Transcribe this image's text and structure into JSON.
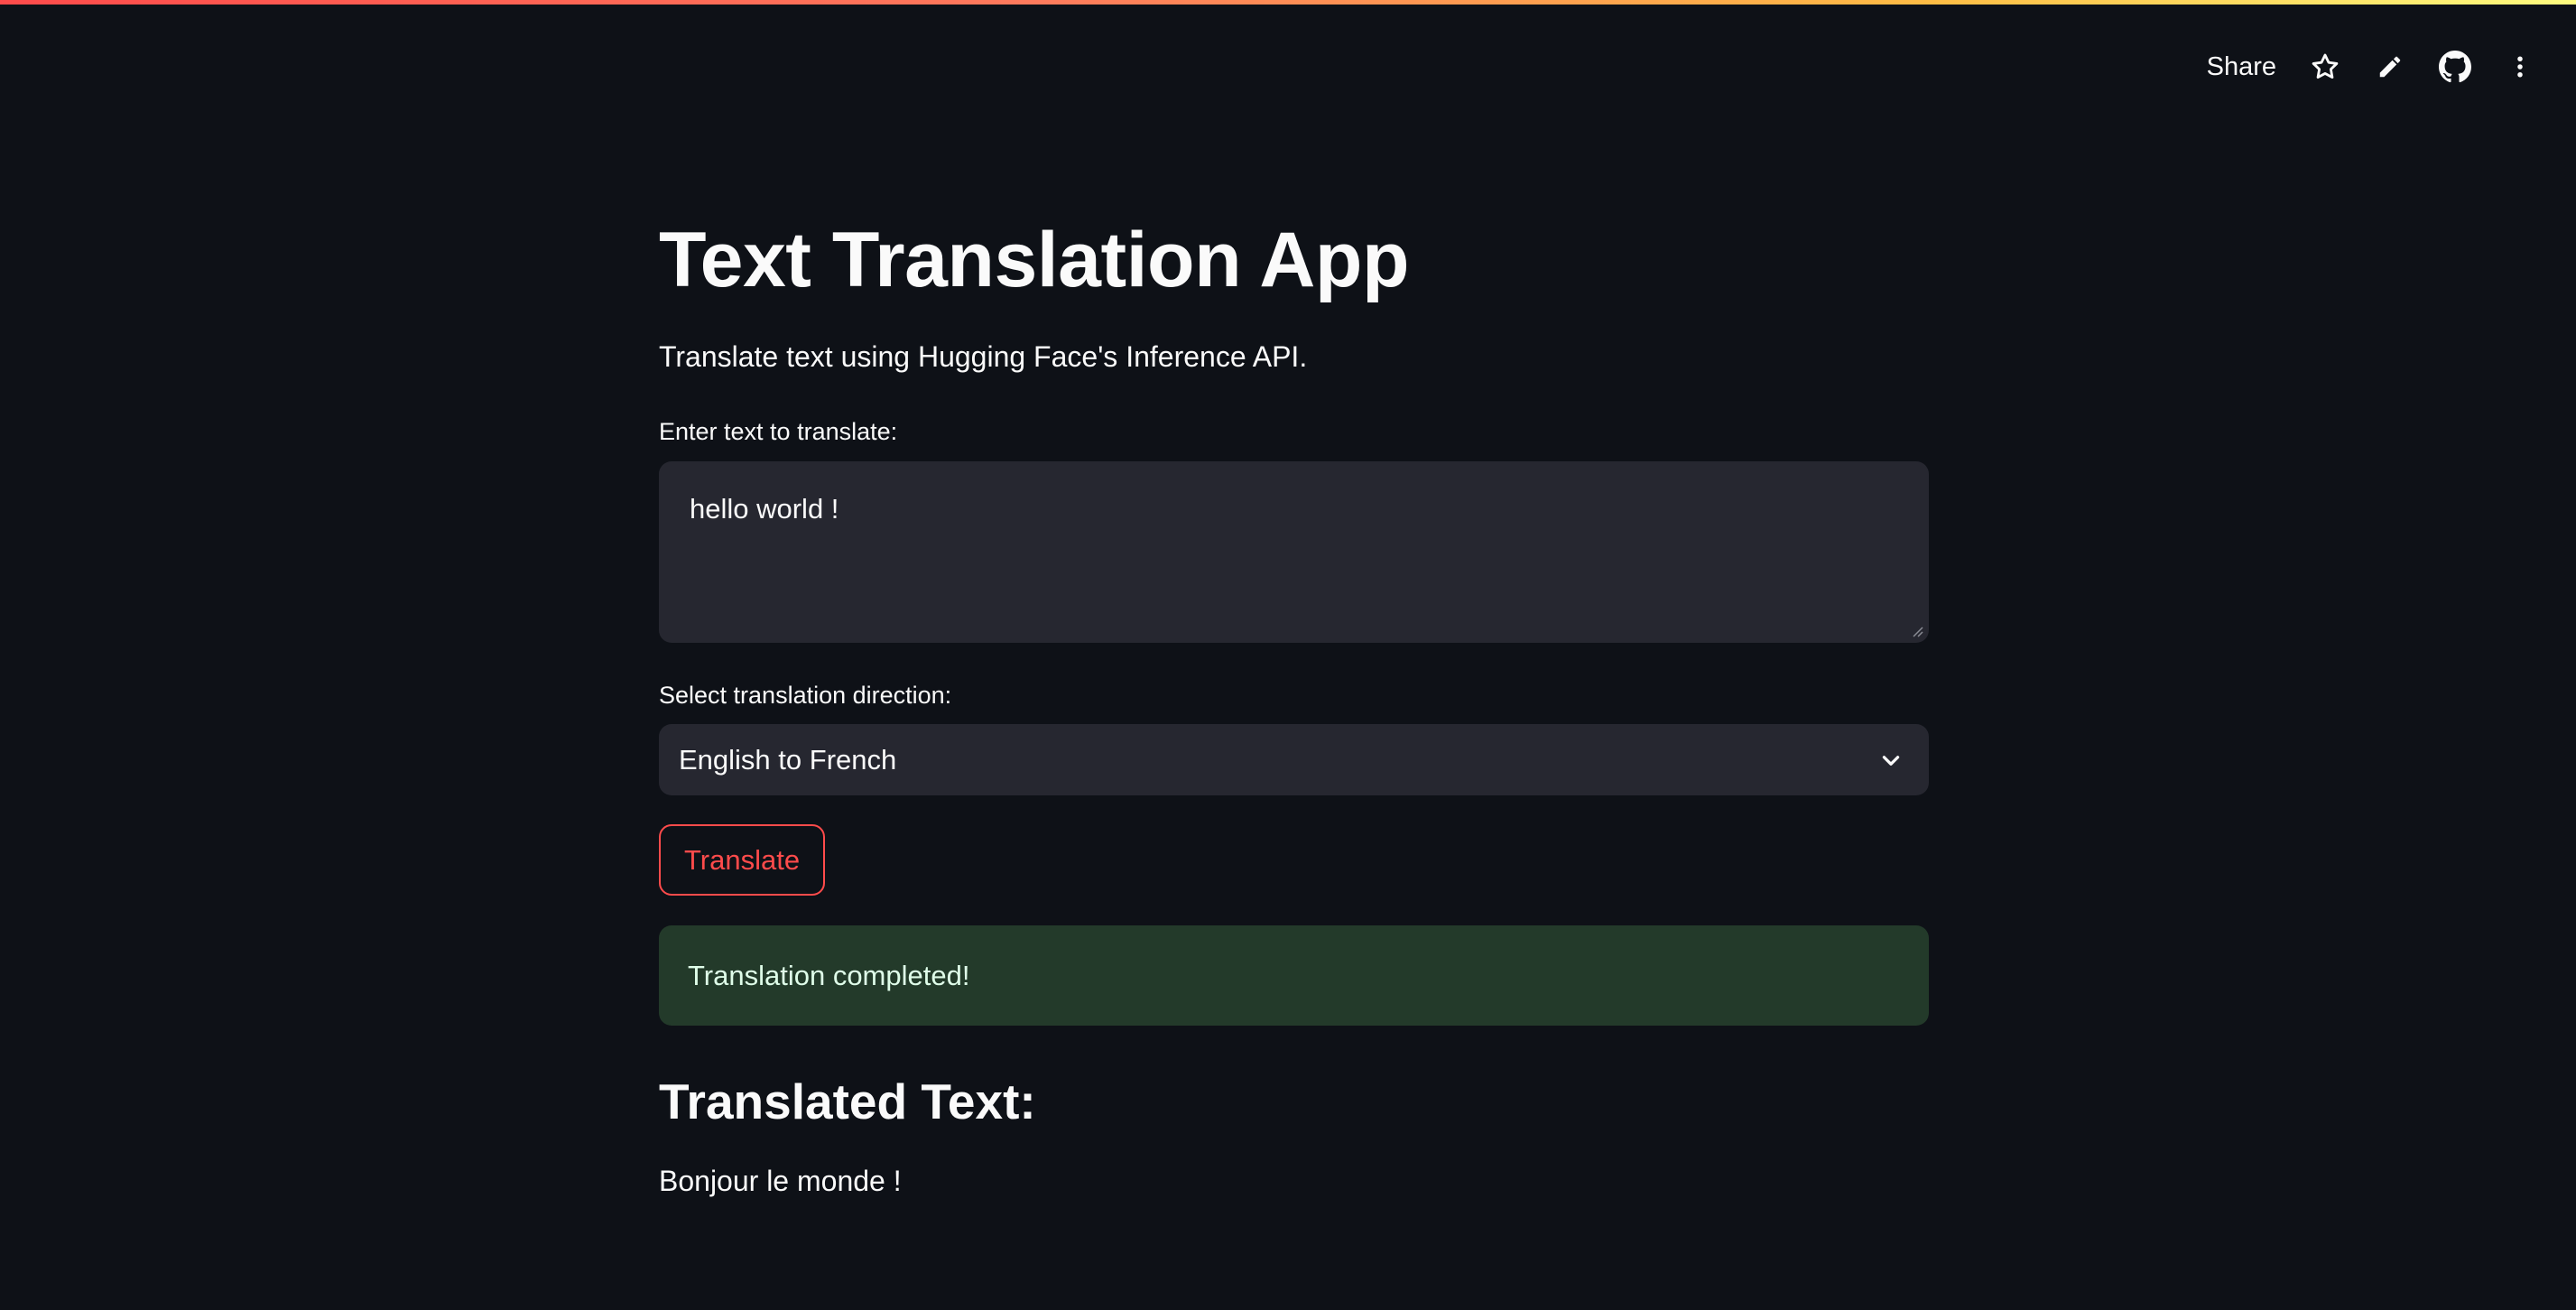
{
  "toolbar": {
    "share_label": "Share",
    "icons": [
      "star-icon",
      "pencil-icon",
      "github-icon",
      "more-vertical-icon"
    ]
  },
  "app": {
    "title": "Text Translation App",
    "subtitle": "Translate text using Hugging Face's Inference API.",
    "input": {
      "label": "Enter text to translate:",
      "value": "hello world !"
    },
    "direction": {
      "label": "Select translation direction:",
      "selected": "English to French"
    },
    "translate_button": "Translate",
    "status_message": "Translation completed!",
    "result": {
      "heading": "Translated Text:",
      "text": "Bonjour le monde !"
    }
  },
  "colors": {
    "background": "#0e1117",
    "widget_bg": "#262730",
    "accent": "#ff4b4b",
    "success_bg": "#233a2a",
    "text": "#fafafa"
  }
}
